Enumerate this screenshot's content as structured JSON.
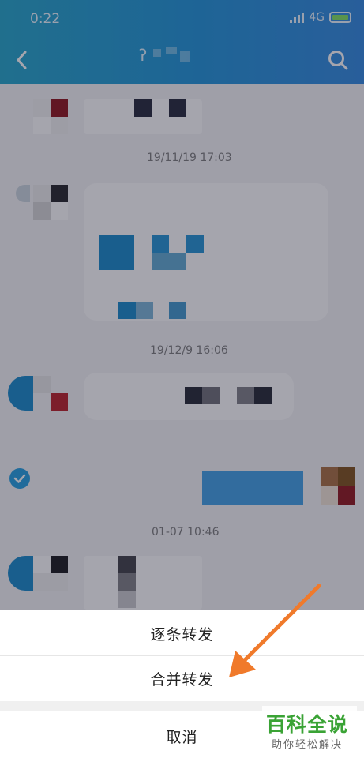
{
  "status_bar": {
    "time": "0:22",
    "network": "4G"
  },
  "header": {
    "back_icon": "chevron-left-icon",
    "search_icon": "search-icon"
  },
  "chat": {
    "timestamps": [
      "19/11/19 17:03",
      "19/12/9 16:06",
      "01-07 10:46"
    ],
    "selected_icon": "check-circle-icon"
  },
  "sheet": {
    "forward_one_by_one": "逐条转发",
    "forward_merged": "合并转发",
    "cancel": "取消"
  },
  "watermark": {
    "title": "百科全说",
    "subtitle": "助你轻松解决"
  },
  "colors": {
    "header": "#1890d8",
    "accent": "#1aa3c9",
    "arrow": "#f07a2b",
    "watermark": "#3aa335"
  }
}
